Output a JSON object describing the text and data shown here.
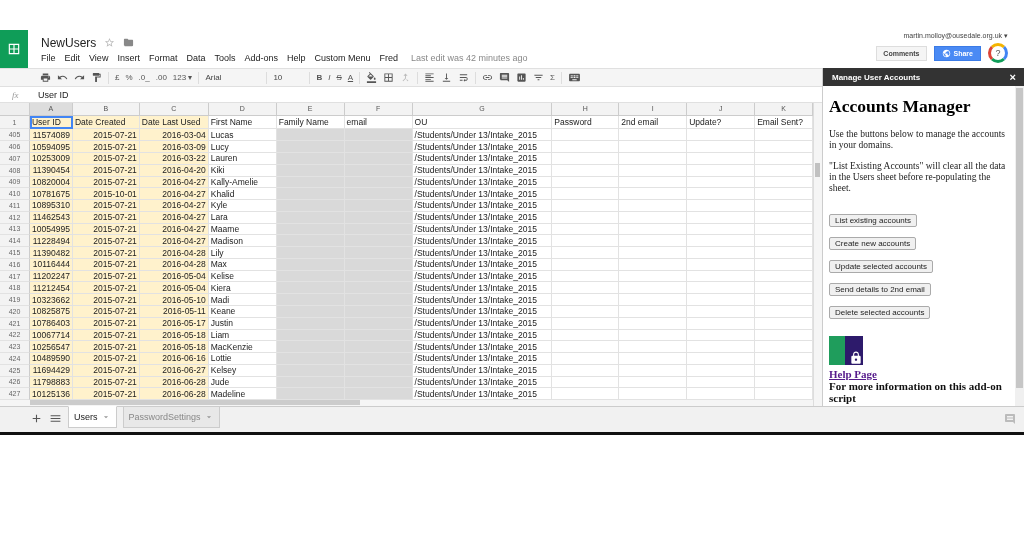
{
  "doc": {
    "title": "NewUsers",
    "last_edit": "Last edit was 42 minutes ago",
    "account": "martin.molloy@ousedale.org.uk ▾"
  },
  "menu": [
    "File",
    "Edit",
    "View",
    "Insert",
    "Format",
    "Data",
    "Tools",
    "Add-ons",
    "Help",
    "Custom Menu",
    "Fred"
  ],
  "actions": {
    "comments": "Comments",
    "share": "Share",
    "help": "?"
  },
  "toolbar": {
    "currency": "£",
    "percent": "%",
    "dec_less": ".0_",
    "dec_more": ".00",
    "more_formats": "123 ▾",
    "font": "Arial",
    "font_size": "10",
    "bold": "B",
    "italic": "I",
    "strike": "S",
    "text_color": "A",
    "sum": "Σ"
  },
  "formula": {
    "fx": "fx",
    "value": "User ID"
  },
  "columns": [
    {
      "letter": "A",
      "header": "User ID",
      "color": "#fff2cc",
      "header_filled": true,
      "selected": true
    },
    {
      "letter": "B",
      "header": "Date Created",
      "color": "#fff2cc",
      "header_filled": true,
      "selected": false
    },
    {
      "letter": "C",
      "header": "Date Last Used",
      "color": "#fff2cc",
      "header_filled": true,
      "selected": false
    },
    {
      "letter": "D",
      "header": "First Name",
      "header_filled": false,
      "selected": false
    },
    {
      "letter": "E",
      "header": "Family Name",
      "color": "#d9d9d9",
      "header_filled": false,
      "selected": false
    },
    {
      "letter": "F",
      "header": "email",
      "color": "#d9d9d9",
      "header_filled": false,
      "selected": false
    },
    {
      "letter": "G",
      "header": "OU",
      "header_filled": false,
      "selected": false
    },
    {
      "letter": "H",
      "header": "Password",
      "header_filled": false,
      "selected": false
    },
    {
      "letter": "I",
      "header": "2nd email",
      "header_filled": false,
      "selected": false
    },
    {
      "letter": "J",
      "header": "Update?",
      "header_filled": false,
      "selected": false
    },
    {
      "letter": "K",
      "header": "Email Sent?",
      "header_filled": false,
      "selected": false
    }
  ],
  "header_row": "1",
  "rows": [
    {
      "num": "405",
      "cells": [
        "11574089",
        "2015-07-21",
        "2016-03-04",
        "Lucas",
        "",
        "",
        "/Students/Under 13/Intake_2015"
      ]
    },
    {
      "num": "406",
      "cells": [
        "10594095",
        "2015-07-21",
        "2016-03-09",
        "Lucy",
        "",
        "",
        "/Students/Under 13/Intake_2015"
      ]
    },
    {
      "num": "407",
      "cells": [
        "10253009",
        "2015-07-21",
        "2016-03-22",
        "Lauren",
        "",
        "",
        "/Students/Under 13/Intake_2015"
      ]
    },
    {
      "num": "408",
      "cells": [
        "11390454",
        "2015-07-21",
        "2016-04-20",
        "Kiki",
        "",
        "",
        "/Students/Under 13/Intake_2015"
      ]
    },
    {
      "num": "409",
      "cells": [
        "10820004",
        "2015-07-21",
        "2016-04-27",
        "Kally-Amelie",
        "",
        "",
        "/Students/Under 13/Intake_2015"
      ]
    },
    {
      "num": "410",
      "cells": [
        "10781675",
        "2015-10-01",
        "2016-04-27",
        "Khalid",
        "",
        "",
        "/Students/Under 13/Intake_2015"
      ]
    },
    {
      "num": "411",
      "cells": [
        "10895310",
        "2015-07-21",
        "2016-04-27",
        "Kyle",
        "",
        "",
        "/Students/Under 13/Intake_2015"
      ]
    },
    {
      "num": "412",
      "cells": [
        "11462543",
        "2015-07-21",
        "2016-04-27",
        "Lara",
        "",
        "",
        "/Students/Under 13/Intake_2015"
      ]
    },
    {
      "num": "413",
      "cells": [
        "10054995",
        "2015-07-21",
        "2016-04-27",
        "Maame",
        "",
        "",
        "/Students/Under 13/Intake_2015"
      ]
    },
    {
      "num": "414",
      "cells": [
        "11228494",
        "2015-07-21",
        "2016-04-27",
        "Madison",
        "",
        "",
        "/Students/Under 13/Intake_2015"
      ]
    },
    {
      "num": "415",
      "cells": [
        "11390482",
        "2015-07-21",
        "2016-04-28",
        "Lily",
        "",
        "",
        "/Students/Under 13/Intake_2015"
      ]
    },
    {
      "num": "416",
      "cells": [
        "10116444",
        "2015-07-21",
        "2016-04-28",
        "Max",
        "",
        "",
        "/Students/Under 13/Intake_2015"
      ]
    },
    {
      "num": "417",
      "cells": [
        "11202247",
        "2015-07-21",
        "2016-05-04",
        "Kelise",
        "",
        "",
        "/Students/Under 13/Intake_2015"
      ]
    },
    {
      "num": "418",
      "cells": [
        "11212454",
        "2015-07-21",
        "2016-05-04",
        "Kiera",
        "",
        "",
        "/Students/Under 13/Intake_2015"
      ]
    },
    {
      "num": "419",
      "cells": [
        "10323662",
        "2015-07-21",
        "2016-05-10",
        "Madi",
        "",
        "",
        "/Students/Under 13/Intake_2015"
      ]
    },
    {
      "num": "420",
      "cells": [
        "10825875",
        "2015-07-21",
        "2016-05-11",
        "Keane",
        "",
        "",
        "/Students/Under 13/Intake_2015"
      ]
    },
    {
      "num": "421",
      "cells": [
        "10786403",
        "2015-07-21",
        "2016-05-17",
        "Justin",
        "",
        "",
        "/Students/Under 13/Intake_2015"
      ]
    },
    {
      "num": "422",
      "cells": [
        "10067714",
        "2015-07-21",
        "2016-05-18",
        "Liam",
        "",
        "",
        "/Students/Under 13/Intake_2015"
      ]
    },
    {
      "num": "423",
      "cells": [
        "10256547",
        "2015-07-21",
        "2016-05-18",
        "MacKenzie",
        "",
        "",
        "/Students/Under 13/Intake_2015"
      ]
    },
    {
      "num": "424",
      "cells": [
        "10489590",
        "2015-07-21",
        "2016-06-16",
        "Lottie",
        "",
        "",
        "/Students/Under 13/Intake_2015"
      ]
    },
    {
      "num": "425",
      "cells": [
        "11694429",
        "2015-07-21",
        "2016-06-27",
        "Kelsey",
        "",
        "",
        "/Students/Under 13/Intake_2015"
      ]
    },
    {
      "num": "426",
      "cells": [
        "11798883",
        "2015-07-21",
        "2016-06-28",
        "Jude",
        "",
        "",
        "/Students/Under 13/Intake_2015"
      ]
    },
    {
      "num": "427",
      "cells": [
        "10125136",
        "2015-07-21",
        "2016-06-28",
        "Madeline",
        "",
        "",
        "/Students/Under 13/Intake_2015"
      ]
    }
  ],
  "sheets": [
    {
      "label": "Users",
      "selected": true
    },
    {
      "label": "PasswordSettings",
      "selected": false
    }
  ],
  "sidebar": {
    "title": "Manage User Accounts",
    "close": "×",
    "heading": "Accounts Manager",
    "paragraphs": [
      "Use the buttons below to manage the accounts in your domains.",
      "\"List Existing Accounts\" will clear all the data in the Users sheet before re-populating the sheet."
    ],
    "buttons": [
      "List existing accounts",
      "Create new accounts",
      "Update selected accounts",
      "Send details to 2nd email",
      "Delete selected accounts"
    ],
    "help_link": "Help Page",
    "footer": "For more information on this add-on script"
  }
}
